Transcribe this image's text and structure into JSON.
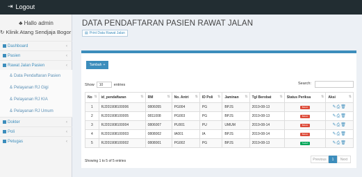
{
  "topbar": {
    "logout_label": "Logout",
    "logout_icon": "sign-out-icon"
  },
  "sidebar": {
    "hello": "Hallo admin",
    "clinic": "Klinik Atang Sendjaja Bogor",
    "items": [
      {
        "label": "Dashboard",
        "type": "main"
      },
      {
        "label": "Pasien",
        "type": "main"
      },
      {
        "label": "Rawat Jalan Pasien",
        "type": "main"
      },
      {
        "label": "Data Pendaftaran Pasien",
        "type": "sub"
      },
      {
        "label": "Pelayanan RJ Gigi",
        "type": "sub"
      },
      {
        "label": "Pelayanan RJ KIA",
        "type": "sub"
      },
      {
        "label": "Pelayanan RJ Umum",
        "type": "sub"
      },
      {
        "label": "Dokter",
        "type": "main"
      },
      {
        "label": "Poli",
        "type": "main"
      },
      {
        "label": "Petugas",
        "type": "main"
      }
    ]
  },
  "page": {
    "title": "DATA PENDAFTARAN PASIEN RAWAT JALAN",
    "print_label": "Print Data Rawat Jalan"
  },
  "box": {
    "tambah_label": "Tambah",
    "show_label": "Show",
    "show_value": "10",
    "entries_label": "entries",
    "search_label": "Search:",
    "columns": [
      "No",
      "id_pendaftaran",
      "RM",
      "No. Antri",
      "ID Poli",
      "Jaminan",
      "Tgl Berobat",
      "Status Periksa",
      "Aksi"
    ],
    "rows": [
      {
        "no": "1",
        "id": "RJ201908100006",
        "rm": "0806055",
        "antri": "PG004",
        "poli": "PG",
        "jaminan": "BPJS",
        "tgl": "2019-08-13",
        "status": "Belum",
        "status_color": "#dd4b39"
      },
      {
        "no": "2",
        "id": "RJ201908100005",
        "rm": "0811008",
        "antri": "PG003",
        "poli": "PG",
        "jaminan": "BPJS",
        "tgl": "2019-08-13",
        "status": "Belum",
        "status_color": "#dd4b39"
      },
      {
        "no": "3",
        "id": "RJ201908100004",
        "rm": "0806007",
        "antri": "PU001",
        "poli": "PU",
        "jaminan": "UMUM",
        "tgl": "2019-08-14",
        "status": "Belum",
        "status_color": "#dd4b39"
      },
      {
        "no": "4",
        "id": "RJ201908100003",
        "rm": "0808002",
        "antri": "IA001",
        "poli": "IA",
        "jaminan": "BPJS",
        "tgl": "2019-08-14",
        "status": "Belum",
        "status_color": "#dd4b39"
      },
      {
        "no": "5",
        "id": "RJ201908100002",
        "rm": "0808001",
        "antri": "PG002",
        "poli": "PG",
        "jaminan": "BPJS",
        "tgl": "2019-08-13",
        "status": "Sudah",
        "status_color": "#00a65a"
      }
    ],
    "info": "Showing 1 to 5 of 5 entries",
    "pager": {
      "prev": "Previous",
      "current": "1",
      "next": "Next"
    }
  },
  "colors": {
    "accent": "#3c8dbc",
    "topbar": "#222d32",
    "danger": "#dd4b39",
    "success": "#00a65a"
  }
}
